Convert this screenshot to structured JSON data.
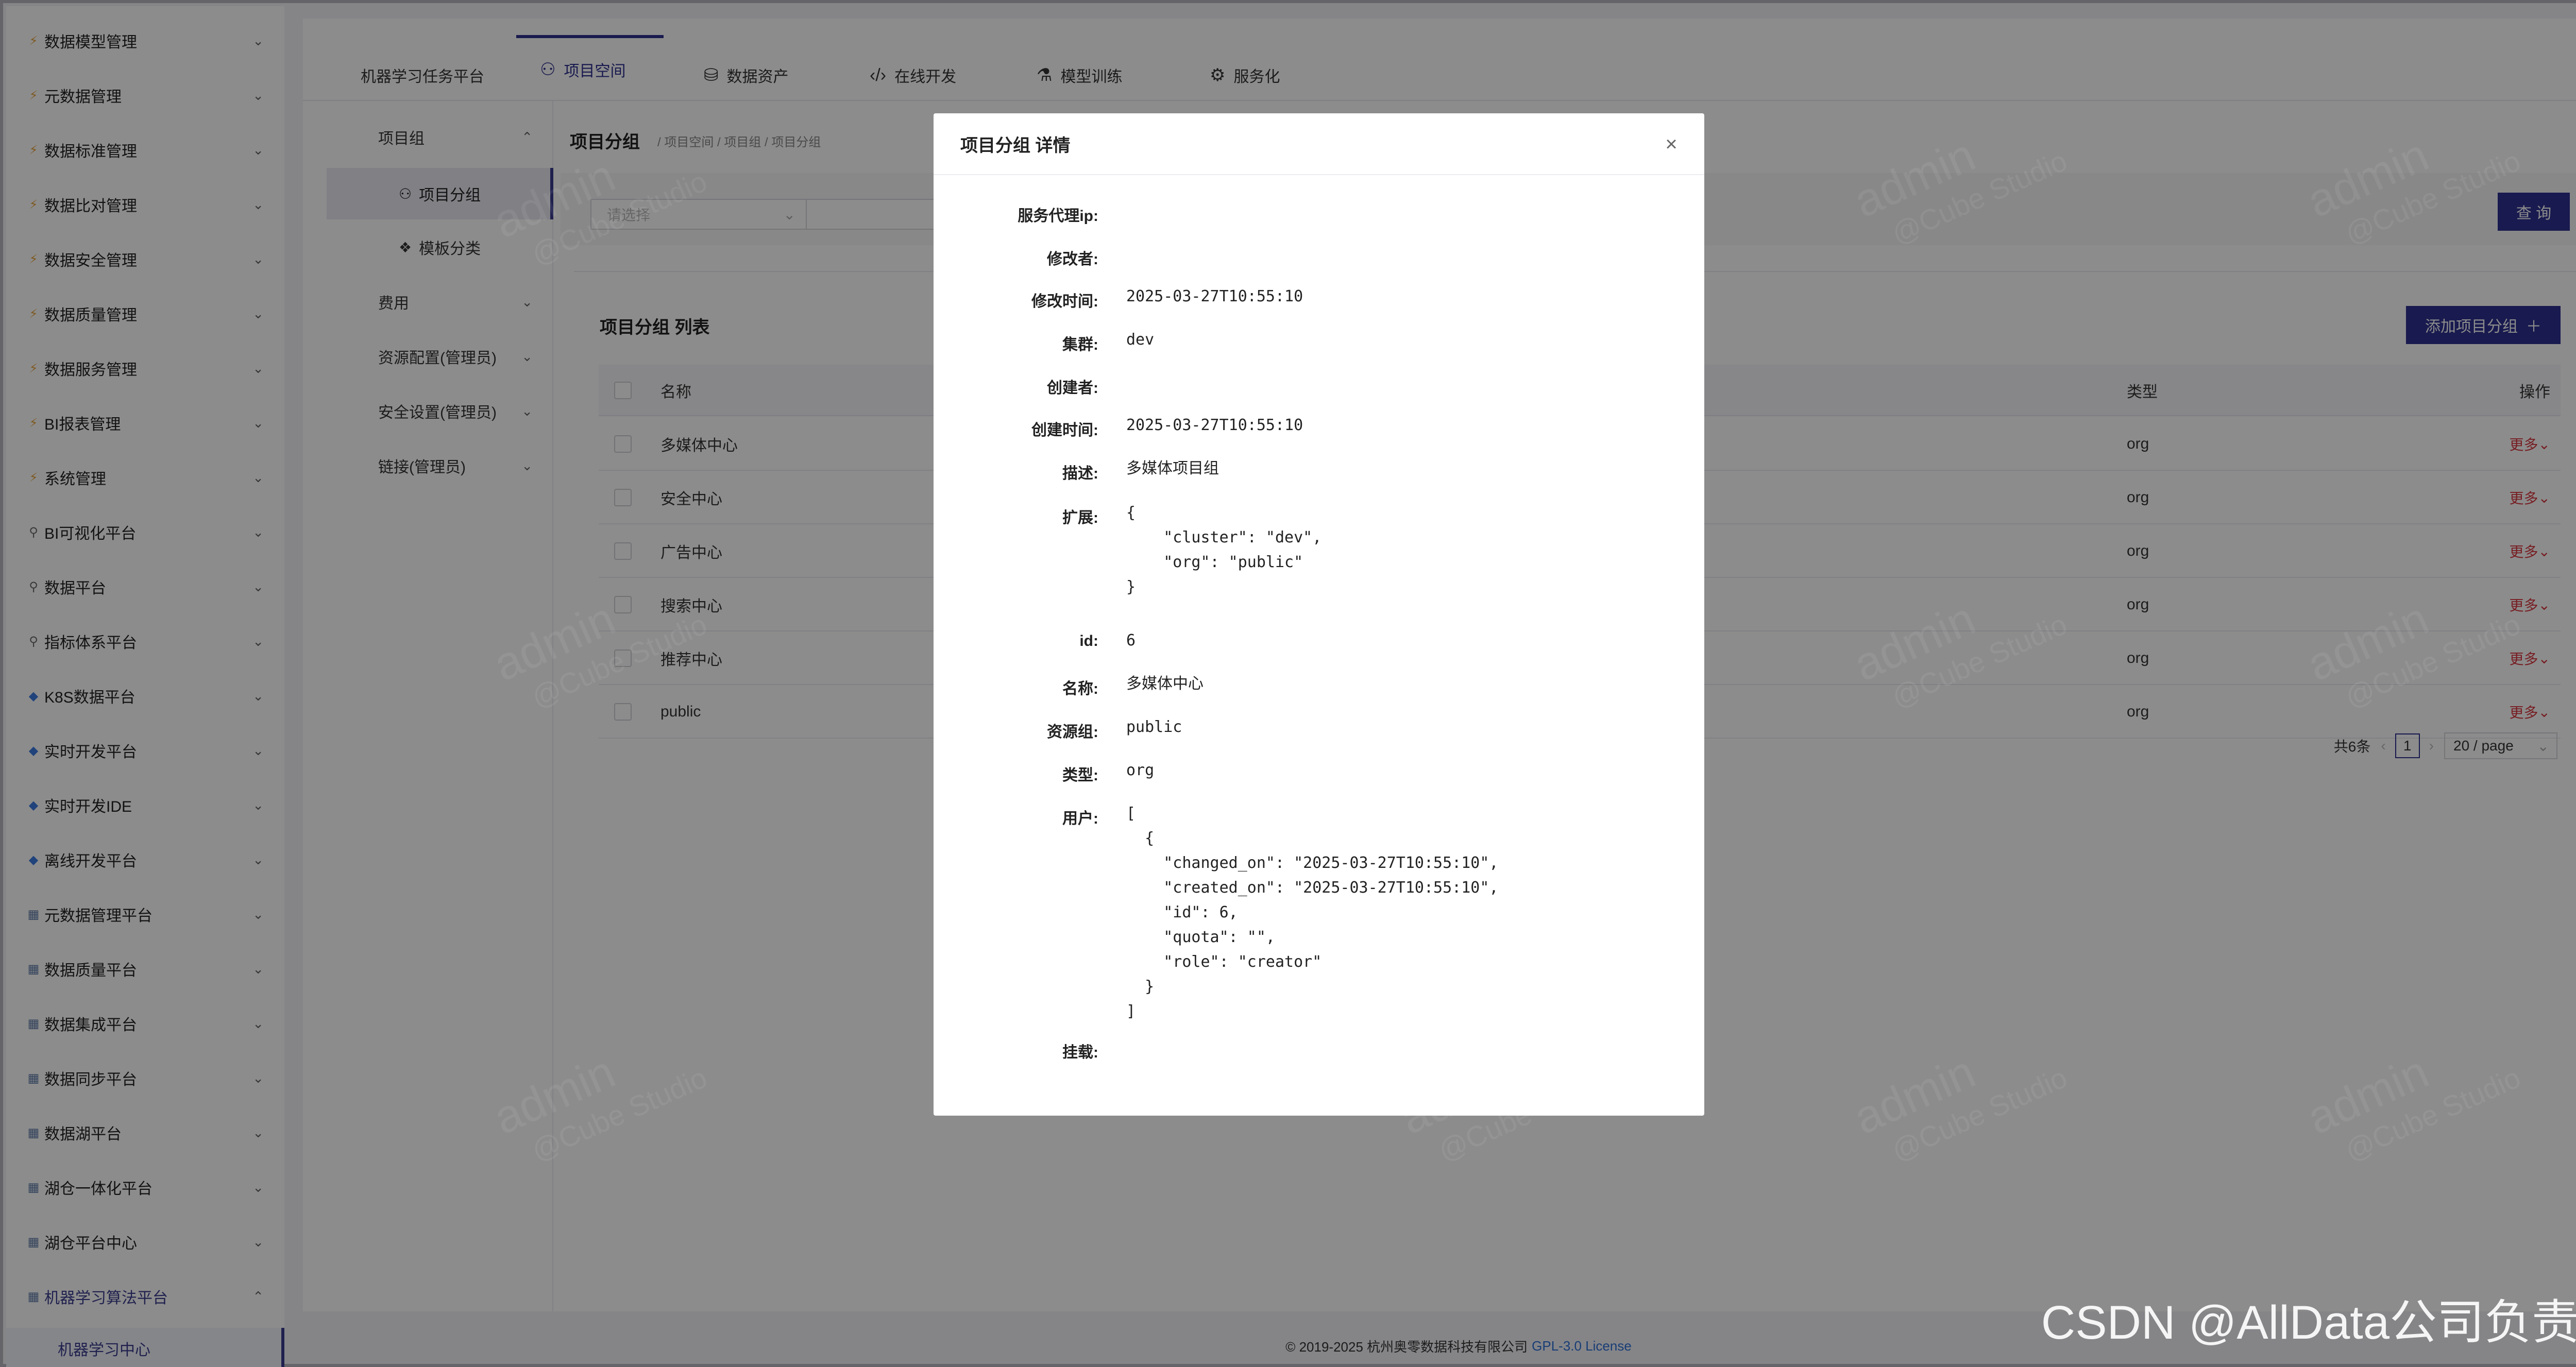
{
  "sidebar": {
    "items": [
      {
        "label": "数据模型管理",
        "icon": "bolt-icon"
      },
      {
        "label": "元数据管理",
        "icon": "bolt-icon"
      },
      {
        "label": "数据标准管理",
        "icon": "bolt-icon"
      },
      {
        "label": "数据比对管理",
        "icon": "bolt-icon"
      },
      {
        "label": "数据安全管理",
        "icon": "bolt-icon"
      },
      {
        "label": "数据质量管理",
        "icon": "bolt-icon"
      },
      {
        "label": "数据服务管理",
        "icon": "bolt-icon"
      },
      {
        "label": "BI报表管理",
        "icon": "bolt-icon"
      },
      {
        "label": "系统管理",
        "icon": "bolt-icon"
      },
      {
        "label": "BI可视化平台",
        "icon": "person-icon"
      },
      {
        "label": "数据平台",
        "icon": "person-icon"
      },
      {
        "label": "指标体系平台",
        "icon": "person-icon"
      },
      {
        "label": "K8S数据平台",
        "icon": "gem-icon"
      },
      {
        "label": "实时开发平台",
        "icon": "gem-icon"
      },
      {
        "label": "实时开发IDE",
        "icon": "gem-icon"
      },
      {
        "label": "离线开发平台",
        "icon": "gem-icon"
      },
      {
        "label": "元数据管理平台",
        "icon": "grid-icon"
      },
      {
        "label": "数据质量平台",
        "icon": "grid-icon"
      },
      {
        "label": "数据集成平台",
        "icon": "grid-icon"
      },
      {
        "label": "数据同步平台",
        "icon": "grid-icon"
      },
      {
        "label": "数据湖平台",
        "icon": "grid-icon"
      },
      {
        "label": "湖仓一体化平台",
        "icon": "grid-icon"
      },
      {
        "label": "湖仓平台中心",
        "icon": "grid-icon"
      },
      {
        "label": "机器学习算法平台",
        "icon": "grid-icon"
      }
    ],
    "active_sub": "机器学习中心"
  },
  "topnav": {
    "tabs": [
      {
        "label": "机器学习任务平台",
        "icon": ""
      },
      {
        "label": "项目空间",
        "icon": "team-icon"
      },
      {
        "label": "数据资产",
        "icon": "database-icon"
      },
      {
        "label": "在线开发",
        "icon": "code-icon"
      },
      {
        "label": "模型训练",
        "icon": "experiment-icon"
      },
      {
        "label": "服务化",
        "icon": "api-icon"
      }
    ]
  },
  "leftmenu": {
    "group": "项目组",
    "sub_items": [
      "项目分组",
      "模板分类"
    ],
    "items": [
      "费用",
      "资源配置(管理员)",
      "安全设置(管理员)",
      "链接(管理员)"
    ]
  },
  "page": {
    "title": "项目分组",
    "breadcrumb": "/ 项目空间 / 项目组 / 项目分组",
    "select_placeholder": "请选择",
    "query_button": "查 询",
    "list_title": "项目分组 列表",
    "add_button": "添加项目分组",
    "columns": {
      "name": "名称",
      "type": "类型",
      "action": "操作"
    },
    "rows": [
      {
        "name": "多媒体中心",
        "type": "org",
        "action": "更多"
      },
      {
        "name": "安全中心",
        "type": "org",
        "action": "更多"
      },
      {
        "name": "广告中心",
        "type": "org",
        "action": "更多"
      },
      {
        "name": "搜索中心",
        "type": "org",
        "action": "更多"
      },
      {
        "name": "推荐中心",
        "type": "org",
        "action": "更多"
      },
      {
        "name": "public",
        "type": "org",
        "action": "更多"
      }
    ],
    "pagination": {
      "total": "共6条",
      "current": "1",
      "page_size": "20 / page"
    }
  },
  "footer": {
    "copyright": "© 2019-2025 杭州奥零数据科技有限公司",
    "license": "GPL-3.0 License"
  },
  "watermark": {
    "user": "admin",
    "brand": "@Cube Studio"
  },
  "corner_watermark": "CSDN @AllData公司负责人",
  "modal": {
    "title": "项目分组 详情",
    "fields": [
      {
        "label": "服务代理ip:",
        "value": ""
      },
      {
        "label": "修改者:",
        "value": ""
      },
      {
        "label": "修改时间:",
        "value": "2025-03-27T10:55:10"
      },
      {
        "label": "集群:",
        "value": "dev"
      },
      {
        "label": "创建者:",
        "value": ""
      },
      {
        "label": "创建时间:",
        "value": "2025-03-27T10:55:10"
      },
      {
        "label": "描述:",
        "value": "多媒体项目组"
      },
      {
        "label": "扩展:",
        "value": "{\n    \"cluster\": \"dev\",\n    \"org\": \"public\"\n}"
      },
      {
        "label": "id:",
        "value": "6"
      },
      {
        "label": "名称:",
        "value": "多媒体中心"
      },
      {
        "label": "资源组:",
        "value": "public"
      },
      {
        "label": "类型:",
        "value": "org"
      },
      {
        "label": "用户:",
        "value": "[\n  {\n    \"changed_on\": \"2025-03-27T10:55:10\",\n    \"created_on\": \"2025-03-27T10:55:10\",\n    \"id\": 6,\n    \"quota\": \"\",\n    \"role\": \"creator\"\n  }\n]"
      },
      {
        "label": "挂载:",
        "value": ""
      }
    ]
  },
  "colors": {
    "primary": "#2f3190",
    "danger": "#d9363e",
    "link": "#2f6fd6"
  }
}
